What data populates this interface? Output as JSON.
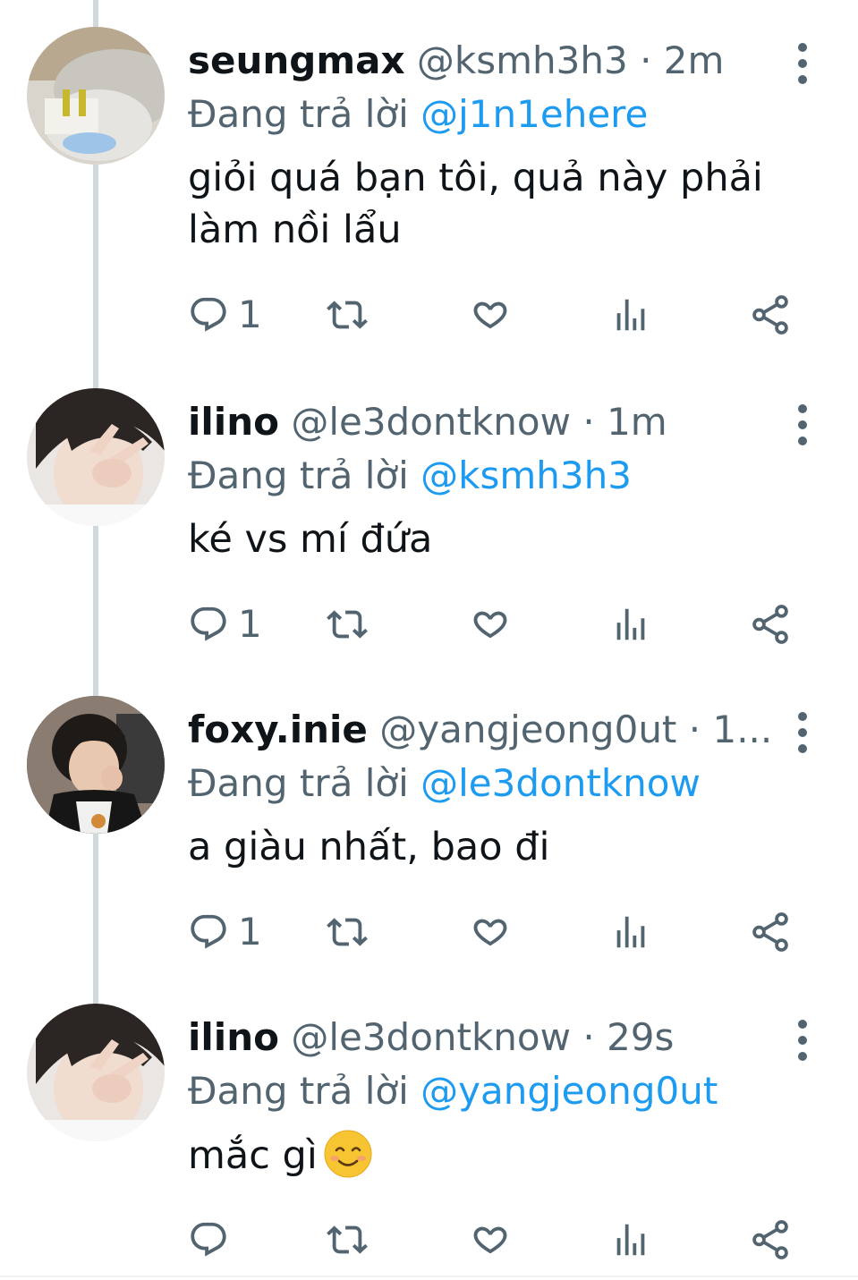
{
  "tweets": [
    {
      "display_name": "seungmax",
      "handle": "@ksmh3h3",
      "separator": "·",
      "time": "2m",
      "reply_prefix": "Đang trả lời",
      "reply_to": "@j1n1ehere",
      "text_line1": "giỏi quá bạn tôi, quả này phải",
      "text_line2": "làm nồi lẩu",
      "reply_count": "1",
      "avatar_icon": "user-avatar-photo"
    },
    {
      "display_name": "ilino",
      "handle": "@le3dontknow",
      "separator": "·",
      "time": "1m",
      "reply_prefix": "Đang trả lời",
      "reply_to": "@ksmh3h3",
      "text_line1": "ké vs mí đứa",
      "reply_count": "1",
      "avatar_icon": "user-avatar-photo"
    },
    {
      "display_name": "foxy.inie",
      "handle": "@yangjeong0ut",
      "separator": "·",
      "time": "1...",
      "reply_prefix": "Đang trả lời",
      "reply_to": "@le3dontknow",
      "text_line1": "a giàu nhất, bao đi",
      "reply_count": "1",
      "avatar_icon": "user-avatar-photo"
    },
    {
      "display_name": "ilino",
      "handle": "@le3dontknow",
      "separator": "·",
      "time": "29s",
      "reply_prefix": "Đang trả lời",
      "reply_to": "@yangjeong0ut",
      "text_line1": "mắc gì",
      "emoji": "smiling-face-emoji",
      "reply_count": "",
      "avatar_icon": "user-avatar-photo"
    }
  ],
  "action_icons": [
    "reply-icon",
    "retweet-icon",
    "like-icon",
    "views-icon",
    "share-icon"
  ],
  "colors": {
    "text": "#0f1419",
    "secondary": "#536471",
    "link": "#1d9bf0",
    "thread_line": "#cfd9de"
  }
}
